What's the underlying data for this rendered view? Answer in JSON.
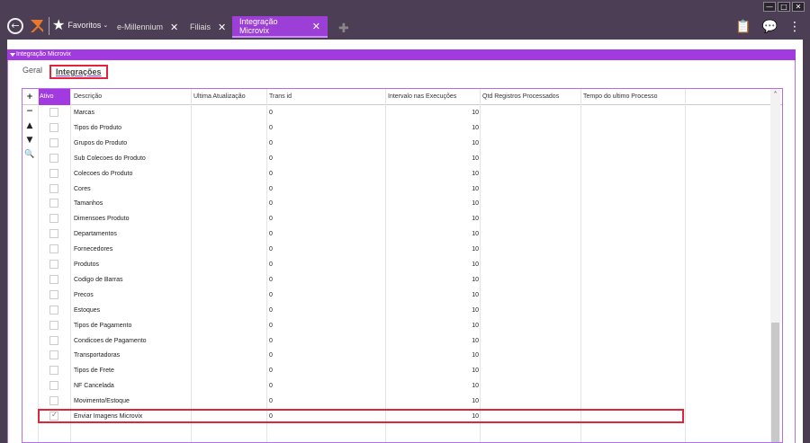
{
  "window": {
    "controls": [
      "—",
      "□",
      "✕"
    ]
  },
  "topbar": {
    "favorites_label": "Favoritos",
    "tabs": [
      {
        "label": "e-Millennium"
      },
      {
        "label": "Filiais"
      },
      {
        "label": "Integração Microvix"
      }
    ]
  },
  "section": {
    "title": "Integração Microvix"
  },
  "subtabs": {
    "geral": "Geral",
    "integracoes": "Integrações"
  },
  "grid": {
    "columns": {
      "ativo": "Ativo",
      "descricao": "Descrição",
      "ultima": "Ultima Atualização",
      "trans": "Trans id",
      "intervalo": "Intervalo nas Execuções",
      "qtd": "Qtd Registros Processados",
      "tempo": "Tempo do ultimo Processo"
    },
    "side_icons": [
      "+",
      "−",
      "▲",
      "▼",
      "🔍"
    ],
    "rows": [
      {
        "desc": "Marcas",
        "trans": "0",
        "intervalo": "10",
        "checked": false
      },
      {
        "desc": "Tipos do Produto",
        "trans": "0",
        "intervalo": "10",
        "checked": false
      },
      {
        "desc": "Grupos do Produto",
        "trans": "0",
        "intervalo": "10",
        "checked": false
      },
      {
        "desc": "Sub Colecoes do Produto",
        "trans": "0",
        "intervalo": "10",
        "checked": false
      },
      {
        "desc": "Colecoes do Produto",
        "trans": "0",
        "intervalo": "10",
        "checked": false
      },
      {
        "desc": "Cores",
        "trans": "0",
        "intervalo": "10",
        "checked": false
      },
      {
        "desc": "Tamanhos",
        "trans": "0",
        "intervalo": "10",
        "checked": false
      },
      {
        "desc": "Dimensoes Produto",
        "trans": "0",
        "intervalo": "10",
        "checked": false
      },
      {
        "desc": "Departamentos",
        "trans": "0",
        "intervalo": "10",
        "checked": false
      },
      {
        "desc": "Fornecedores",
        "trans": "0",
        "intervalo": "10",
        "checked": false
      },
      {
        "desc": "Produtos",
        "trans": "0",
        "intervalo": "10",
        "checked": false
      },
      {
        "desc": "Codigo de Barras",
        "trans": "0",
        "intervalo": "10",
        "checked": false
      },
      {
        "desc": "Precos",
        "trans": "0",
        "intervalo": "10",
        "checked": false
      },
      {
        "desc": "Estoques",
        "trans": "0",
        "intervalo": "10",
        "checked": false
      },
      {
        "desc": "Tipos de Pagamento",
        "trans": "0",
        "intervalo": "10",
        "checked": false
      },
      {
        "desc": "Condicoes de Pagamento",
        "trans": "0",
        "intervalo": "10",
        "checked": false
      },
      {
        "desc": "Transportadoras",
        "trans": "0",
        "intervalo": "10",
        "checked": false
      },
      {
        "desc": "Tipos de Frete",
        "trans": "0",
        "intervalo": "10",
        "checked": false
      },
      {
        "desc": "NF Cancelada",
        "trans": "0",
        "intervalo": "10",
        "checked": false
      },
      {
        "desc": "Movimento/Estoque",
        "trans": "0",
        "intervalo": "10",
        "checked": false
      },
      {
        "desc": "Enviar Imagens Microvix",
        "trans": "0",
        "intervalo": "10",
        "checked": true
      }
    ]
  },
  "colors": {
    "accent": "#a13be0",
    "highlight_border": "#e0243a",
    "topbar": "#4c3f55"
  }
}
